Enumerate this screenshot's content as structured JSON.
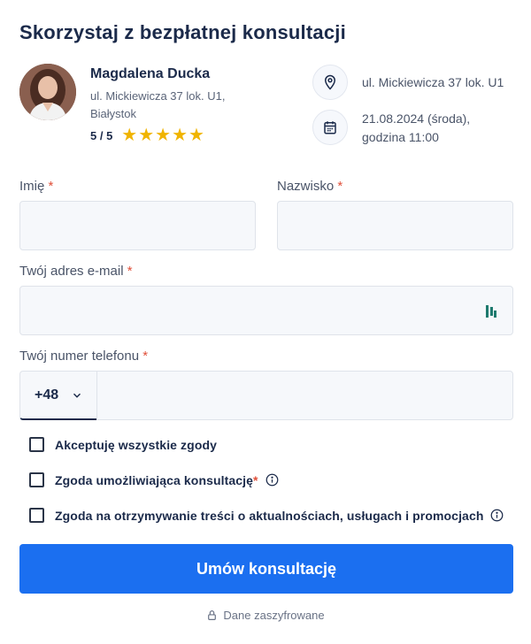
{
  "title": "Skorzystaj z bezpłatnej konsultacji",
  "advisor": {
    "name": "Magdalena Ducka",
    "address_line1": "ul. Mickiewicza 37 lok. U1,",
    "address_line2": "Białystok",
    "rating": "5 / 5",
    "stars": 5
  },
  "appointment": {
    "location": "ul. Mickiewicza 37 lok. U1",
    "date_line1": "21.08.2024 (środa),",
    "date_line2": "godzina 11:00"
  },
  "form": {
    "first_name_label": "Imię",
    "last_name_label": "Nazwisko",
    "email_label": "Twój adres e-mail",
    "phone_label": "Twój numer telefonu",
    "required_mark": "*",
    "phone_prefix": "+48"
  },
  "consents": [
    {
      "label": "Akceptuję wszystkie zgody",
      "required": false,
      "info": false
    },
    {
      "label": "Zgoda umożliwiająca konsultację",
      "required": true,
      "info": true
    },
    {
      "label": "Zgoda na otrzymywanie treści o aktualnościach, usługach i promocjach",
      "required": false,
      "info": true
    }
  ],
  "submit_label": "Umów konsultację",
  "secure_note": "Dane zaszyfrowane",
  "colors": {
    "primary": "#1b6ff0",
    "star": "#f0b400",
    "required": "#e0503a"
  }
}
